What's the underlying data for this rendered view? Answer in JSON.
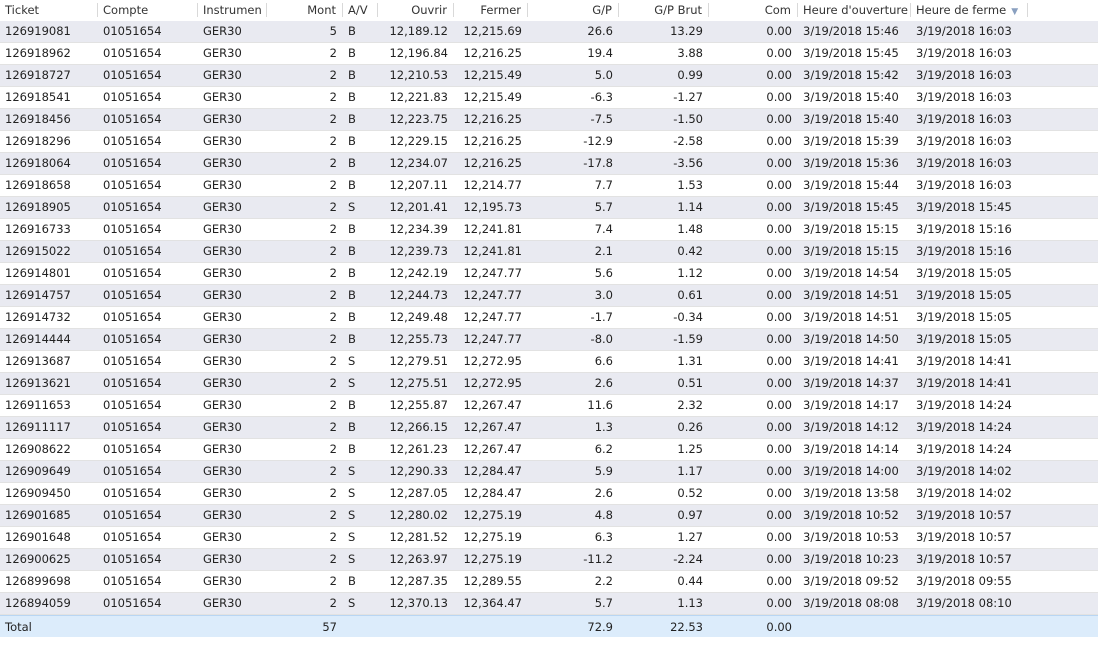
{
  "columns": {
    "ticket": "Ticket",
    "account": "Compte",
    "instrument": "Instrumen",
    "amount": "Mont",
    "side": "A/V",
    "open": "Ouvrir",
    "close": "Fermer",
    "pl": "G/P",
    "pl_gross": "G/P Brut",
    "commission": "Com",
    "open_time": "Heure d'ouverture",
    "close_time": "Heure de ferme"
  },
  "sort": {
    "column": "close_time",
    "direction": "descending",
    "icon": "sort-desc-icon"
  },
  "rows": [
    {
      "ticket": "126919081",
      "account": "01051654",
      "instrument": "GER30",
      "amount": "5",
      "side": "B",
      "open": "12,189.12",
      "close": "12,215.69",
      "pl": "26.6",
      "pl_gross": "13.29",
      "commission": "0.00",
      "open_time": "3/19/2018 15:46",
      "close_time": "3/19/2018 16:03"
    },
    {
      "ticket": "126918962",
      "account": "01051654",
      "instrument": "GER30",
      "amount": "2",
      "side": "B",
      "open": "12,196.84",
      "close": "12,216.25",
      "pl": "19.4",
      "pl_gross": "3.88",
      "commission": "0.00",
      "open_time": "3/19/2018 15:45",
      "close_time": "3/19/2018 16:03"
    },
    {
      "ticket": "126918727",
      "account": "01051654",
      "instrument": "GER30",
      "amount": "2",
      "side": "B",
      "open": "12,210.53",
      "close": "12,215.49",
      "pl": "5.0",
      "pl_gross": "0.99",
      "commission": "0.00",
      "open_time": "3/19/2018 15:42",
      "close_time": "3/19/2018 16:03"
    },
    {
      "ticket": "126918541",
      "account": "01051654",
      "instrument": "GER30",
      "amount": "2",
      "side": "B",
      "open": "12,221.83",
      "close": "12,215.49",
      "pl": "-6.3",
      "pl_gross": "-1.27",
      "commission": "0.00",
      "open_time": "3/19/2018 15:40",
      "close_time": "3/19/2018 16:03"
    },
    {
      "ticket": "126918456",
      "account": "01051654",
      "instrument": "GER30",
      "amount": "2",
      "side": "B",
      "open": "12,223.75",
      "close": "12,216.25",
      "pl": "-7.5",
      "pl_gross": "-1.50",
      "commission": "0.00",
      "open_time": "3/19/2018 15:40",
      "close_time": "3/19/2018 16:03"
    },
    {
      "ticket": "126918296",
      "account": "01051654",
      "instrument": "GER30",
      "amount": "2",
      "side": "B",
      "open": "12,229.15",
      "close": "12,216.25",
      "pl": "-12.9",
      "pl_gross": "-2.58",
      "commission": "0.00",
      "open_time": "3/19/2018 15:39",
      "close_time": "3/19/2018 16:03"
    },
    {
      "ticket": "126918064",
      "account": "01051654",
      "instrument": "GER30",
      "amount": "2",
      "side": "B",
      "open": "12,234.07",
      "close": "12,216.25",
      "pl": "-17.8",
      "pl_gross": "-3.56",
      "commission": "0.00",
      "open_time": "3/19/2018 15:36",
      "close_time": "3/19/2018 16:03"
    },
    {
      "ticket": "126918658",
      "account": "01051654",
      "instrument": "GER30",
      "amount": "2",
      "side": "B",
      "open": "12,207.11",
      "close": "12,214.77",
      "pl": "7.7",
      "pl_gross": "1.53",
      "commission": "0.00",
      "open_time": "3/19/2018 15:44",
      "close_time": "3/19/2018 16:03"
    },
    {
      "ticket": "126918905",
      "account": "01051654",
      "instrument": "GER30",
      "amount": "2",
      "side": "S",
      "open": "12,201.41",
      "close": "12,195.73",
      "pl": "5.7",
      "pl_gross": "1.14",
      "commission": "0.00",
      "open_time": "3/19/2018 15:45",
      "close_time": "3/19/2018 15:45"
    },
    {
      "ticket": "126916733",
      "account": "01051654",
      "instrument": "GER30",
      "amount": "2",
      "side": "B",
      "open": "12,234.39",
      "close": "12,241.81",
      "pl": "7.4",
      "pl_gross": "1.48",
      "commission": "0.00",
      "open_time": "3/19/2018 15:15",
      "close_time": "3/19/2018 15:16"
    },
    {
      "ticket": "126915022",
      "account": "01051654",
      "instrument": "GER30",
      "amount": "2",
      "side": "B",
      "open": "12,239.73",
      "close": "12,241.81",
      "pl": "2.1",
      "pl_gross": "0.42",
      "commission": "0.00",
      "open_time": "3/19/2018 15:15",
      "close_time": "3/19/2018 15:16"
    },
    {
      "ticket": "126914801",
      "account": "01051654",
      "instrument": "GER30",
      "amount": "2",
      "side": "B",
      "open": "12,242.19",
      "close": "12,247.77",
      "pl": "5.6",
      "pl_gross": "1.12",
      "commission": "0.00",
      "open_time": "3/19/2018 14:54",
      "close_time": "3/19/2018 15:05"
    },
    {
      "ticket": "126914757",
      "account": "01051654",
      "instrument": "GER30",
      "amount": "2",
      "side": "B",
      "open": "12,244.73",
      "close": "12,247.77",
      "pl": "3.0",
      "pl_gross": "0.61",
      "commission": "0.00",
      "open_time": "3/19/2018 14:51",
      "close_time": "3/19/2018 15:05"
    },
    {
      "ticket": "126914732",
      "account": "01051654",
      "instrument": "GER30",
      "amount": "2",
      "side": "B",
      "open": "12,249.48",
      "close": "12,247.77",
      "pl": "-1.7",
      "pl_gross": "-0.34",
      "commission": "0.00",
      "open_time": "3/19/2018 14:51",
      "close_time": "3/19/2018 15:05"
    },
    {
      "ticket": "126914444",
      "account": "01051654",
      "instrument": "GER30",
      "amount": "2",
      "side": "B",
      "open": "12,255.73",
      "close": "12,247.77",
      "pl": "-8.0",
      "pl_gross": "-1.59",
      "commission": "0.00",
      "open_time": "3/19/2018 14:50",
      "close_time": "3/19/2018 15:05"
    },
    {
      "ticket": "126913687",
      "account": "01051654",
      "instrument": "GER30",
      "amount": "2",
      "side": "S",
      "open": "12,279.51",
      "close": "12,272.95",
      "pl": "6.6",
      "pl_gross": "1.31",
      "commission": "0.00",
      "open_time": "3/19/2018 14:41",
      "close_time": "3/19/2018 14:41"
    },
    {
      "ticket": "126913621",
      "account": "01051654",
      "instrument": "GER30",
      "amount": "2",
      "side": "S",
      "open": "12,275.51",
      "close": "12,272.95",
      "pl": "2.6",
      "pl_gross": "0.51",
      "commission": "0.00",
      "open_time": "3/19/2018 14:37",
      "close_time": "3/19/2018 14:41"
    },
    {
      "ticket": "126911653",
      "account": "01051654",
      "instrument": "GER30",
      "amount": "2",
      "side": "B",
      "open": "12,255.87",
      "close": "12,267.47",
      "pl": "11.6",
      "pl_gross": "2.32",
      "commission": "0.00",
      "open_time": "3/19/2018 14:17",
      "close_time": "3/19/2018 14:24"
    },
    {
      "ticket": "126911117",
      "account": "01051654",
      "instrument": "GER30",
      "amount": "2",
      "side": "B",
      "open": "12,266.15",
      "close": "12,267.47",
      "pl": "1.3",
      "pl_gross": "0.26",
      "commission": "0.00",
      "open_time": "3/19/2018 14:12",
      "close_time": "3/19/2018 14:24"
    },
    {
      "ticket": "126908622",
      "account": "01051654",
      "instrument": "GER30",
      "amount": "2",
      "side": "B",
      "open": "12,261.23",
      "close": "12,267.47",
      "pl": "6.2",
      "pl_gross": "1.25",
      "commission": "0.00",
      "open_time": "3/19/2018 14:14",
      "close_time": "3/19/2018 14:24"
    },
    {
      "ticket": "126909649",
      "account": "01051654",
      "instrument": "GER30",
      "amount": "2",
      "side": "S",
      "open": "12,290.33",
      "close": "12,284.47",
      "pl": "5.9",
      "pl_gross": "1.17",
      "commission": "0.00",
      "open_time": "3/19/2018 14:00",
      "close_time": "3/19/2018 14:02"
    },
    {
      "ticket": "126909450",
      "account": "01051654",
      "instrument": "GER30",
      "amount": "2",
      "side": "S",
      "open": "12,287.05",
      "close": "12,284.47",
      "pl": "2.6",
      "pl_gross": "0.52",
      "commission": "0.00",
      "open_time": "3/19/2018 13:58",
      "close_time": "3/19/2018 14:02"
    },
    {
      "ticket": "126901685",
      "account": "01051654",
      "instrument": "GER30",
      "amount": "2",
      "side": "S",
      "open": "12,280.02",
      "close": "12,275.19",
      "pl": "4.8",
      "pl_gross": "0.97",
      "commission": "0.00",
      "open_time": "3/19/2018 10:52",
      "close_time": "3/19/2018 10:57"
    },
    {
      "ticket": "126901648",
      "account": "01051654",
      "instrument": "GER30",
      "amount": "2",
      "side": "S",
      "open": "12,281.52",
      "close": "12,275.19",
      "pl": "6.3",
      "pl_gross": "1.27",
      "commission": "0.00",
      "open_time": "3/19/2018 10:53",
      "close_time": "3/19/2018 10:57"
    },
    {
      "ticket": "126900625",
      "account": "01051654",
      "instrument": "GER30",
      "amount": "2",
      "side": "S",
      "open": "12,263.97",
      "close": "12,275.19",
      "pl": "-11.2",
      "pl_gross": "-2.24",
      "commission": "0.00",
      "open_time": "3/19/2018 10:23",
      "close_time": "3/19/2018 10:57"
    },
    {
      "ticket": "126899698",
      "account": "01051654",
      "instrument": "GER30",
      "amount": "2",
      "side": "B",
      "open": "12,287.35",
      "close": "12,289.55",
      "pl": "2.2",
      "pl_gross": "0.44",
      "commission": "0.00",
      "open_time": "3/19/2018 09:52",
      "close_time": "3/19/2018 09:55"
    },
    {
      "ticket": "126894059",
      "account": "01051654",
      "instrument": "GER30",
      "amount": "2",
      "side": "S",
      "open": "12,370.13",
      "close": "12,364.47",
      "pl": "5.7",
      "pl_gross": "1.13",
      "commission": "0.00",
      "open_time": "3/19/2018 08:08",
      "close_time": "3/19/2018 08:10"
    }
  ],
  "totals": {
    "label": "Total",
    "amount": "57",
    "pl": "72.9",
    "pl_gross": "22.53",
    "commission": "0.00"
  },
  "colors": {
    "row_alt": "#e9eaf1",
    "total_bg": "#dcecfb",
    "sort_icon": "#8aa0c0"
  }
}
